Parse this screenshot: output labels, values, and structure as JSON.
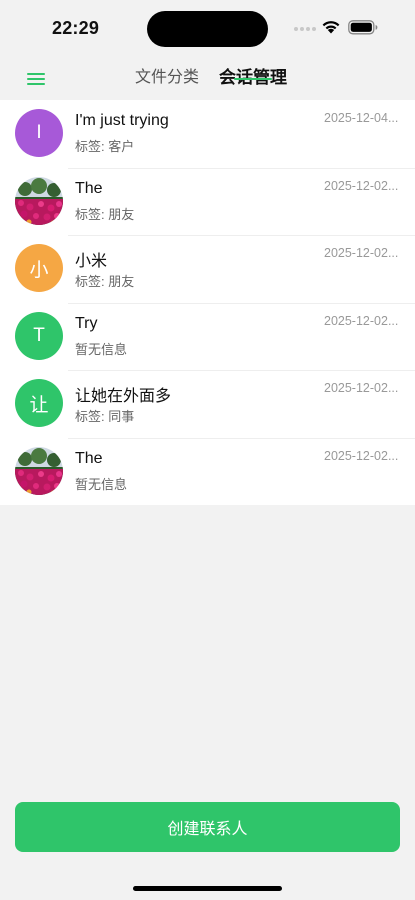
{
  "status": {
    "time": "22:29"
  },
  "header": {
    "tabs": [
      {
        "label": "文件分类"
      },
      {
        "label": "会话管理"
      }
    ]
  },
  "contacts": [
    {
      "initial": "I",
      "name": "I'm just trying",
      "sub": "标签: 客户",
      "date": "2025-12-04...",
      "avatar_type": "letter",
      "avatar_color": "#a759d8"
    },
    {
      "initial": "",
      "name": "The",
      "sub": "标签: 朋友",
      "date": "2025-12-02...",
      "avatar_type": "flower-photo",
      "avatar_color": ""
    },
    {
      "initial": "小",
      "name": "小米",
      "sub": "标签: 朋友",
      "date": "2025-12-02...",
      "avatar_type": "letter",
      "avatar_color": "#f5a744"
    },
    {
      "initial": "T",
      "name": "Try",
      "sub": "暂无信息",
      "date": "2025-12-02...",
      "avatar_type": "letter",
      "avatar_color": "#2fc56a"
    },
    {
      "initial": "让",
      "name": "让她在外面多",
      "sub": "标签: 同事",
      "date": "2025-12-02...",
      "avatar_type": "letter",
      "avatar_color": "#2fc56a"
    },
    {
      "initial": "",
      "name": "The",
      "sub": "暂无信息",
      "date": "2025-12-02...",
      "avatar_type": "flower-photo",
      "avatar_color": ""
    }
  ],
  "footer": {
    "create_label": "创建联系人"
  },
  "theme": {
    "accent": "#2fc56a",
    "background": "#f2f2f2"
  }
}
